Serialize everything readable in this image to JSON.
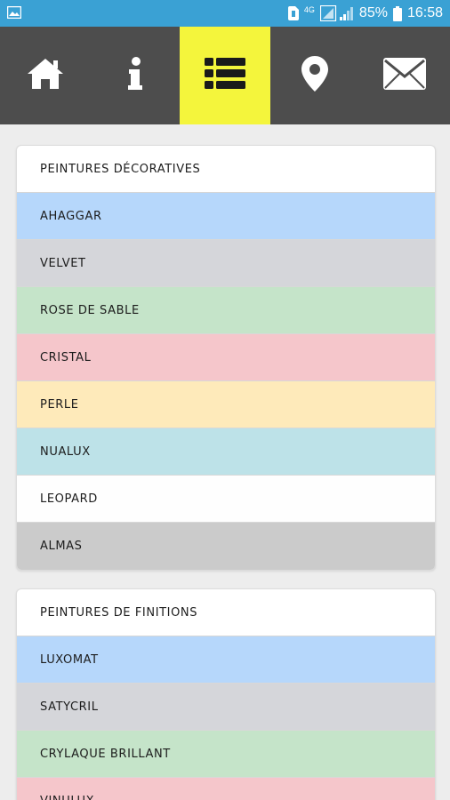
{
  "status_bar": {
    "network": "4G",
    "battery": "85%",
    "time": "16:58"
  },
  "nav": {
    "items": [
      {
        "icon": "home-icon",
        "active": false
      },
      {
        "icon": "info-icon",
        "active": false
      },
      {
        "icon": "list-icon",
        "active": true
      },
      {
        "icon": "location-pin-icon",
        "active": false
      },
      {
        "icon": "mail-icon",
        "active": false
      }
    ],
    "active_color": "#f4f53c"
  },
  "sections": [
    {
      "title": "PEINTURES DÉCORATIVES",
      "items": [
        {
          "label": "AHAGGAR",
          "color": "#b6d7fb"
        },
        {
          "label": "VELVET",
          "color": "#d5d6da"
        },
        {
          "label": "ROSE DE SABLE",
          "color": "#c5e4c9"
        },
        {
          "label": "CRISTAL",
          "color": "#f5c6cb"
        },
        {
          "label": "PERLE",
          "color": "#feeaba"
        },
        {
          "label": "NUALUX",
          "color": "#bde2e8"
        },
        {
          "label": "LEOPARD",
          "color": "#fefefe"
        },
        {
          "label": "ALMAS",
          "color": "#cbcbcb"
        }
      ]
    },
    {
      "title": "PEINTURES DE FINITIONS",
      "items": [
        {
          "label": "LUXOMAT",
          "color": "#b6d7fb"
        },
        {
          "label": "SATYCRIL",
          "color": "#d5d6da"
        },
        {
          "label": "CRYLAQUE BRILLANT",
          "color": "#c5e4c9"
        },
        {
          "label": "VINULUX",
          "color": "#f5c6cb"
        }
      ]
    }
  ]
}
